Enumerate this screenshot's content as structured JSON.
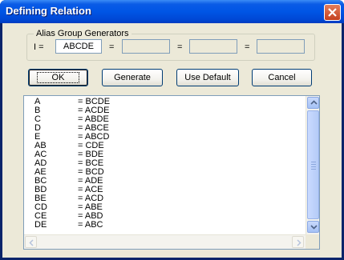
{
  "window": {
    "title": "Defining Relation"
  },
  "alias_group": {
    "legend": "Alias Group Generators",
    "prefix_label": "I =",
    "equals_label": "=",
    "fields": [
      "ABCDE",
      "",
      "",
      ""
    ]
  },
  "buttons": {
    "ok": "OK",
    "generate": "Generate",
    "use_default": "Use Default",
    "cancel": "Cancel"
  },
  "aliases": [
    {
      "term": "A",
      "alias": "= BCDE"
    },
    {
      "term": "B",
      "alias": "= ACDE"
    },
    {
      "term": "C",
      "alias": "= ABDE"
    },
    {
      "term": "D",
      "alias": "= ABCE"
    },
    {
      "term": "E",
      "alias": "= ABCD"
    },
    {
      "term": "AB",
      "alias": "= CDE"
    },
    {
      "term": "AC",
      "alias": "= BDE"
    },
    {
      "term": "AD",
      "alias": "= BCE"
    },
    {
      "term": "AE",
      "alias": "= BCD"
    },
    {
      "term": "BC",
      "alias": "= ADE"
    },
    {
      "term": "BD",
      "alias": "= ACE"
    },
    {
      "term": "BE",
      "alias": "= ACD"
    },
    {
      "term": "CD",
      "alias": "= ABE"
    },
    {
      "term": "CE",
      "alias": "= ABD"
    },
    {
      "term": "DE",
      "alias": "= ABC"
    }
  ]
}
